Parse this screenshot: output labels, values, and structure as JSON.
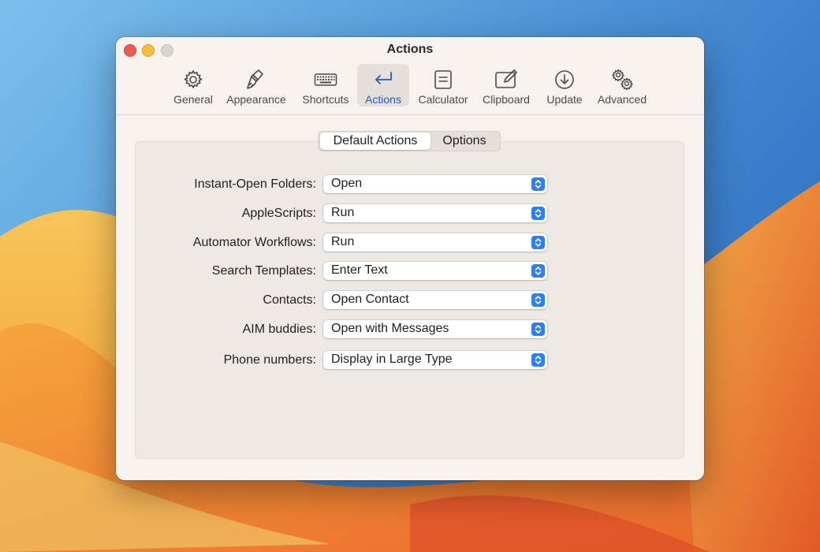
{
  "window": {
    "title": "Actions"
  },
  "toolbar": {
    "tabs": [
      {
        "label": "General",
        "icon": "gear-icon"
      },
      {
        "label": "Appearance",
        "icon": "paintbrush-icon"
      },
      {
        "label": "Shortcuts",
        "icon": "keyboard-icon"
      },
      {
        "label": "Actions",
        "icon": "return-arrow-icon",
        "selected": true
      },
      {
        "label": "Calculator",
        "icon": "calculator-icon"
      },
      {
        "label": "Clipboard",
        "icon": "clipboard-edit-icon"
      },
      {
        "label": "Update",
        "icon": "download-circle-icon"
      },
      {
        "label": "Advanced",
        "icon": "gears-icon"
      }
    ]
  },
  "segmented": {
    "default_actions": "Default Actions",
    "options": "Options",
    "selected": "Default Actions"
  },
  "settings": [
    {
      "label": "Instant-Open Folders:",
      "value": "Open"
    },
    {
      "label": "AppleScripts:",
      "value": "Run"
    },
    {
      "label": "Automator Workflows:",
      "value": "Run"
    },
    {
      "label": "Search Templates:",
      "value": "Enter Text"
    },
    {
      "label": "Contacts:",
      "value": "Open Contact"
    },
    {
      "label": "AIM buddies:",
      "value": "Open with Messages"
    },
    {
      "label": "Phone numbers:",
      "value": "Display in Large Type"
    }
  ],
  "colors": {
    "accent": "#2d7ef7",
    "selected_tab_text": "#1f5bc7"
  }
}
